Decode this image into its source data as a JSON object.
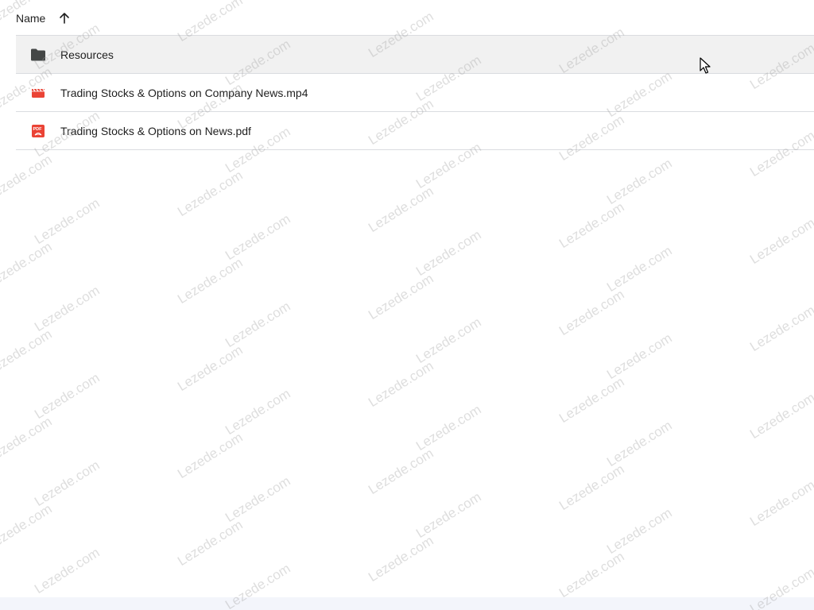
{
  "header": {
    "name_label": "Name",
    "sort_icon": "arrow-up-icon"
  },
  "files": [
    {
      "name": "Resources",
      "icon": "folder-icon",
      "selected": true
    },
    {
      "name": "Trading Stocks & Options on Company News.mp4",
      "icon": "video-file-icon",
      "selected": false
    },
    {
      "name": "Trading Stocks & Options on News.pdf",
      "icon": "pdf-file-icon",
      "selected": false
    }
  ],
  "colors": {
    "selected_row": "#f1f1f1",
    "divider": "#dadce0",
    "folder": "#444746",
    "file_red": "#ea4335"
  }
}
